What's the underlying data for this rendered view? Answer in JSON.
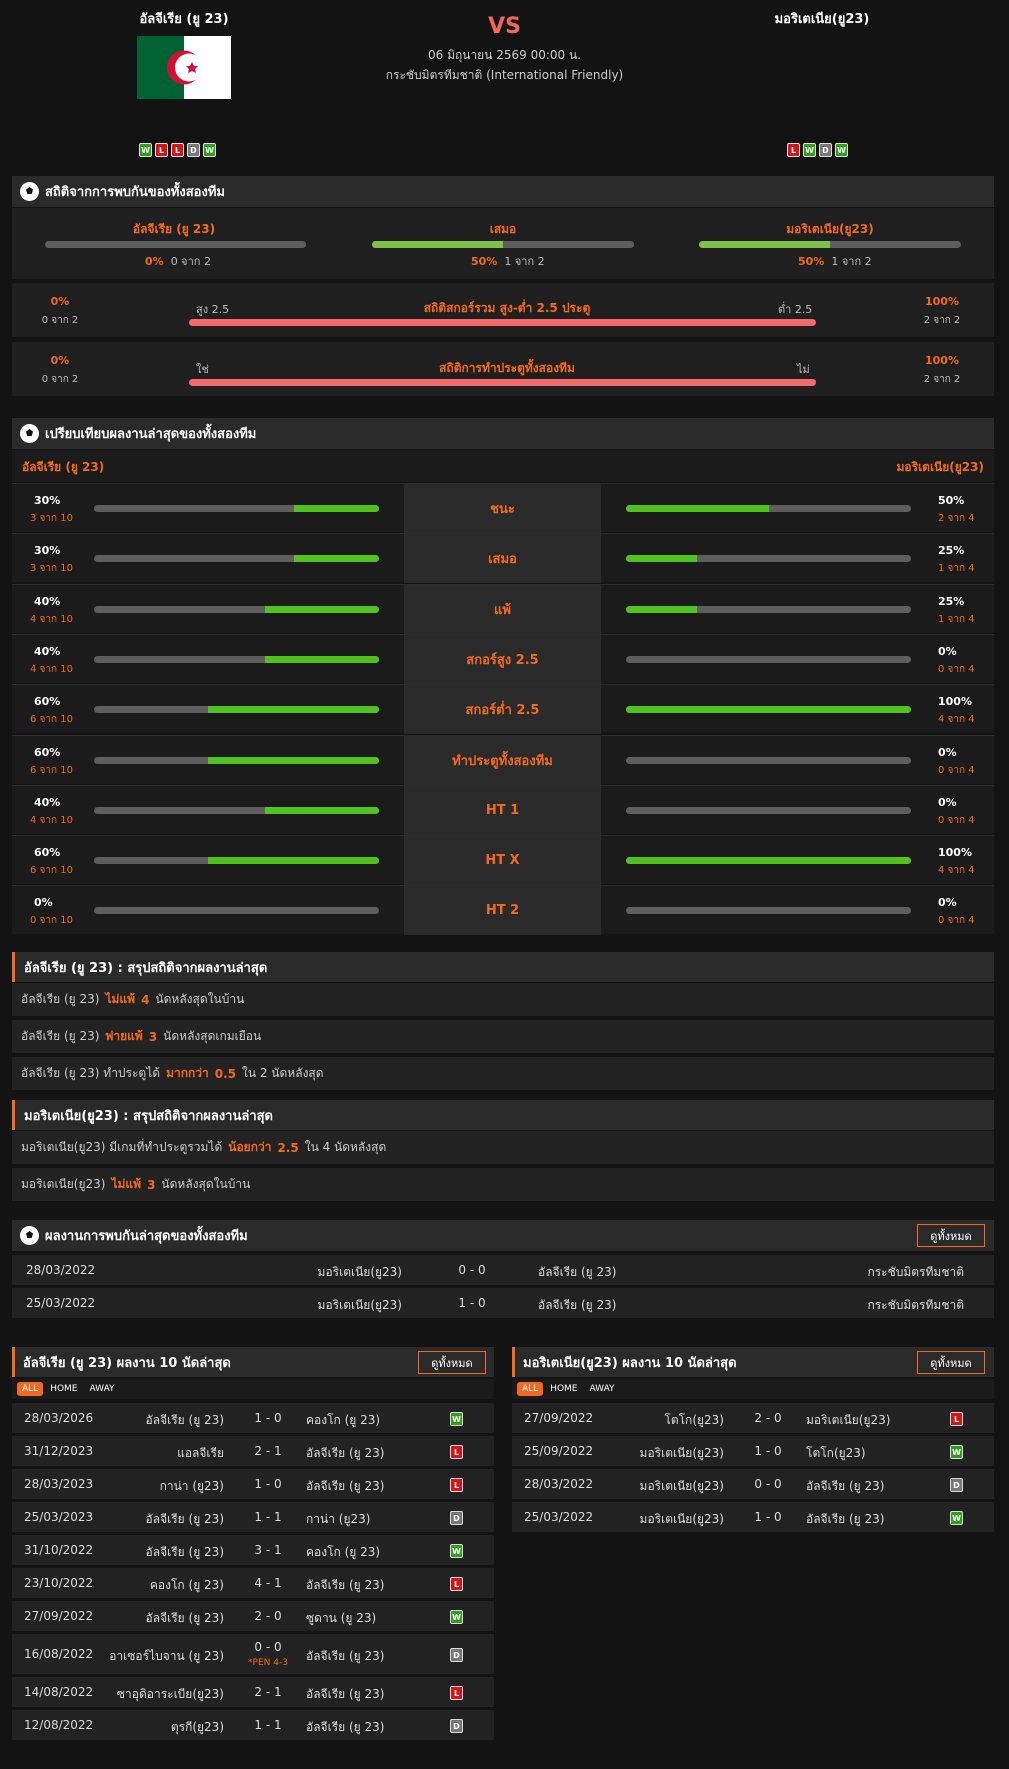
{
  "header": {
    "home_team": "อัลจีเรีย (ยู 23)",
    "away_team": "มอริเตเนีย(ยู23)",
    "vs": "VS",
    "date": "06 มิถุนายน 2569 00:00 น.",
    "competition": "กระชับมิตรทีมชาติ (International Friendly)",
    "home_form": [
      "W",
      "L",
      "L",
      "D",
      "W"
    ],
    "away_form": [
      "L",
      "W",
      "D",
      "W"
    ]
  },
  "h2h_stats": {
    "title": "สถิติจากการพบกันของทั้งสองทีม",
    "cols": [
      {
        "label": "อัลจีเรีย (ยู 23)",
        "pct": "0%",
        "count": "0 จาก 2",
        "fill": 0
      },
      {
        "label": "เสมอ",
        "pct": "50%",
        "count": "1 จาก 2",
        "fill": 0.5
      },
      {
        "label": "มอริเตเนีย(ยู23)",
        "pct": "50%",
        "count": "1 จาก 2",
        "fill": 0.5
      }
    ],
    "rows": [
      {
        "left_pct": "0%",
        "left_count": "0 จาก 2",
        "left_label": "สูง 2.5",
        "title": "สถิติสกอร์รวม สูง-ต่ำ 2.5 ประตู",
        "right_label": "ต่ำ 2.5",
        "right_pct": "100%",
        "right_count": "2 จาก 2"
      },
      {
        "left_pct": "0%",
        "left_count": "0 จาก 2",
        "left_label": "ใช่",
        "title": "สถิติการทำประตูทั้งสองทีม",
        "right_label": "ไม่",
        "right_pct": "100%",
        "right_count": "2 จาก 2"
      }
    ]
  },
  "compare": {
    "title": "เปรียบเทียบผลงานล่าสุดของทั้งสองทีม",
    "home": "อัลจีเรีย (ยู 23)",
    "away": "มอริเตเนีย(ยู23)",
    "rows": [
      {
        "label": "ชนะ",
        "lp": "30%",
        "lc": "3 จาก 10",
        "lf": 0.3,
        "rp": "50%",
        "rc": "2 จาก 4",
        "rf": 0.5
      },
      {
        "label": "เสมอ",
        "lp": "30%",
        "lc": "3 จาก 10",
        "lf": 0.3,
        "rp": "25%",
        "rc": "1 จาก 4",
        "rf": 0.25
      },
      {
        "label": "แพ้",
        "lp": "40%",
        "lc": "4 จาก 10",
        "lf": 0.4,
        "rp": "25%",
        "rc": "1 จาก 4",
        "rf": 0.25
      },
      {
        "label": "สกอร์สูง 2.5",
        "lp": "40%",
        "lc": "4 จาก 10",
        "lf": 0.4,
        "rp": "0%",
        "rc": "0 จาก 4",
        "rf": 0
      },
      {
        "label": "สกอร์ต่ำ 2.5",
        "lp": "60%",
        "lc": "6 จาก 10",
        "lf": 0.6,
        "rp": "100%",
        "rc": "4 จาก 4",
        "rf": 1
      },
      {
        "label": "ทำประตูทั้งสองทีม",
        "lp": "60%",
        "lc": "6 จาก 10",
        "lf": 0.6,
        "rp": "0%",
        "rc": "0 จาก 4",
        "rf": 0
      },
      {
        "label": "HT 1",
        "lp": "40%",
        "lc": "4 จาก 10",
        "lf": 0.4,
        "rp": "0%",
        "rc": "0 จาก 4",
        "rf": 0
      },
      {
        "label": "HT X",
        "lp": "60%",
        "lc": "6 จาก 10",
        "lf": 0.6,
        "rp": "100%",
        "rc": "4 จาก 4",
        "rf": 1
      },
      {
        "label": "HT 2",
        "lp": "0%",
        "lc": "0 จาก 10",
        "lf": 0,
        "rp": "0%",
        "rc": "0 จาก 4",
        "rf": 0
      }
    ]
  },
  "home_summary": {
    "title": "อัลจีเรีย (ยู 23) : สรุปสถิติจากผลงานล่าสุด",
    "rows": [
      [
        "อัลจีเรีย (ยู 23)",
        "ไม่แพ้",
        "4",
        "นัดหลังสุดในบ้าน"
      ],
      [
        "อัลจีเรีย (ยู 23)",
        "พ่ายแพ้",
        "3",
        "นัดหลังสุดเกมเยือน"
      ],
      [
        "อัลจีเรีย (ยู 23) ทำประตูได้",
        "มากกว่า",
        "0.5",
        "ใน 2 นัดหลังสุด"
      ]
    ]
  },
  "away_summary": {
    "title": "มอริเตเนีย(ยู23) : สรุปสถิติจากผลงานล่าสุด",
    "rows": [
      [
        "มอริเตเนีย(ยู23) มีเกมที่ทำประตูรวมได้",
        "น้อยกว่า",
        "2.5",
        "ใน 4 นัดหลังสุด"
      ],
      [
        "มอริเตเนีย(ยู23)",
        "ไม่แพ้",
        "3",
        "นัดหลังสุดในบ้าน"
      ]
    ]
  },
  "h2h_results": {
    "title": "ผลงานการพบกันล่าสุดของทั้งสองทีม",
    "view_all": "ดูทั้งหมด",
    "rows": [
      {
        "date": "28/03/2022",
        "home": "มอริเตเนีย(ยู23)",
        "score": "0 - 0",
        "away": "อัลจีเรีย (ยู 23)",
        "comp": "กระชับมิตรทีมชาติ"
      },
      {
        "date": "25/03/2022",
        "home": "มอริเตเนีย(ยู23)",
        "score": "1 - 0",
        "away": "อัลจีเรีย (ยู 23)",
        "comp": "กระชับมิตรทีมชาติ"
      }
    ]
  },
  "home_last": {
    "title": "อัลจีเรีย (ยู 23) ผลงาน 10 นัดล่าสุด",
    "view_all": "ดูทั้งหมด",
    "tabs": [
      "ALL",
      "HOME",
      "AWAY"
    ],
    "rows": [
      {
        "date": "28/03/2026",
        "home": "อัลจีเรีย (ยู 23)",
        "score": "1 - 0",
        "away": "คองโก (ยู 23)",
        "res": "W"
      },
      {
        "date": "31/12/2023",
        "home": "แอลจีเรีย",
        "score": "2 - 1",
        "away": "อัลจีเรีย (ยู 23)",
        "res": "L"
      },
      {
        "date": "28/03/2023",
        "home": "กาน่า (ยู23)",
        "score": "1 - 0",
        "away": "อัลจีเรีย (ยู 23)",
        "res": "L"
      },
      {
        "date": "25/03/2023",
        "home": "อัลจีเรีย (ยู 23)",
        "score": "1 - 1",
        "away": "กาน่า (ยู23)",
        "res": "D"
      },
      {
        "date": "31/10/2022",
        "home": "อัลจีเรีย (ยู 23)",
        "score": "3 - 1",
        "away": "คองโก (ยู 23)",
        "res": "W"
      },
      {
        "date": "23/10/2022",
        "home": "คองโก (ยู 23)",
        "score": "4 - 1",
        "away": "อัลจีเรีย (ยู 23)",
        "res": "L"
      },
      {
        "date": "27/09/2022",
        "home": "อัลจีเรีย (ยู 23)",
        "score": "2 - 0",
        "away": "ซูดาน (ยู 23)",
        "res": "W"
      },
      {
        "date": "16/08/2022",
        "home": "อาเซอร์ไบจาน (ยู 23)",
        "score": "0 - 0",
        "note": "*PEN 4-3",
        "away": "อัลจีเรีย (ยู 23)",
        "res": "D"
      },
      {
        "date": "14/08/2022",
        "home": "ซาอุดิอาระเบีย(ยู23)",
        "score": "2 - 1",
        "away": "อัลจีเรีย (ยู 23)",
        "res": "L"
      },
      {
        "date": "12/08/2022",
        "home": "ตุรกี(ยู23)",
        "score": "1 - 1",
        "away": "อัลจีเรีย (ยู 23)",
        "res": "D"
      }
    ]
  },
  "away_last": {
    "title": "มอริเตเนีย(ยู23) ผลงาน 10 นัดล่าสุด",
    "view_all": "ดูทั้งหมด",
    "tabs": [
      "ALL",
      "HOME",
      "AWAY"
    ],
    "rows": [
      {
        "date": "27/09/2022",
        "home": "โตโก(ยู23)",
        "score": "2 - 0",
        "away": "มอริเตเนีย(ยู23)",
        "res": "L"
      },
      {
        "date": "25/09/2022",
        "home": "มอริเตเนีย(ยู23)",
        "score": "1 - 0",
        "away": "โตโก(ยู23)",
        "res": "W"
      },
      {
        "date": "28/03/2022",
        "home": "มอริเตเนีย(ยู23)",
        "score": "0 - 0",
        "away": "อัลจีเรีย (ยู 23)",
        "res": "D"
      },
      {
        "date": "25/03/2022",
        "home": "มอริเตเนีย(ยู23)",
        "score": "1 - 0",
        "away": "อัลจีเรีย (ยู 23)",
        "res": "W"
      }
    ]
  }
}
